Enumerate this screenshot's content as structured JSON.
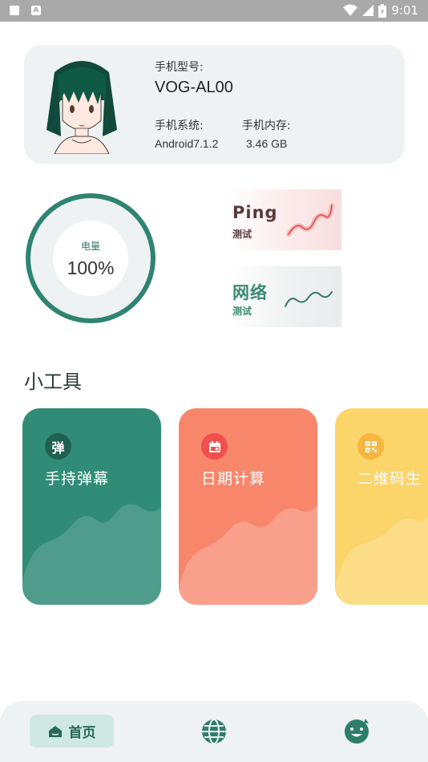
{
  "status_bar": {
    "time": "9:01"
  },
  "device": {
    "model_label": "手机型号:",
    "model_value": "VOG-AL00",
    "os_label": "手机系统:",
    "os_value": "Android7.1.2",
    "memory_label": "手机内存:",
    "memory_value": "3.46 GB"
  },
  "battery": {
    "label": "电量",
    "value": "100%",
    "level": 1.0
  },
  "tests": {
    "ping": {
      "title": "Ping",
      "sub": "测试"
    },
    "network": {
      "title": "网络",
      "sub": "测试"
    }
  },
  "tools_title": "小工具",
  "tools": [
    {
      "label": "手持弹幕",
      "badge": "弹",
      "color": "#318c76"
    },
    {
      "label": "日期计算",
      "badge": "calendar-icon",
      "color": "#f7866b"
    },
    {
      "label": "二维码生",
      "badge": "qr-icon",
      "color": "#fbd46a"
    }
  ],
  "nav": {
    "home_label": "首页"
  }
}
